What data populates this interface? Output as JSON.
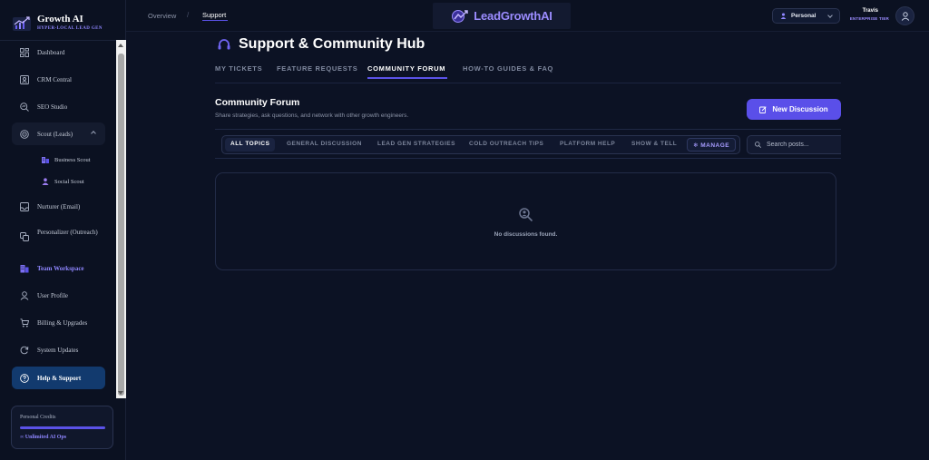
{
  "sidebar": {
    "brand_title": "Growth AI",
    "brand_subtitle": "HYPER-LOCAL LEAD GEN",
    "items": [
      {
        "label": "Dashboard",
        "icon": "grid-icon"
      },
      {
        "label": "CRM Central",
        "icon": "contact-card-icon"
      },
      {
        "label": "SEO Studio",
        "icon": "search-chart-icon"
      },
      {
        "label": "Scout (Leads)",
        "icon": "target-icon",
        "expanded": true
      },
      {
        "label": "Nurturer (Email)",
        "icon": "inbox-icon"
      },
      {
        "label": "Personalizer (Outreach)",
        "icon": "copy-icon"
      },
      {
        "label": "Team Workspace",
        "icon": "building-icon"
      },
      {
        "label": "User Profile",
        "icon": "user-icon"
      },
      {
        "label": "Billing & Upgrades",
        "icon": "cart-icon"
      },
      {
        "label": "System Updates",
        "icon": "refresh-icon"
      },
      {
        "label": "Help & Support",
        "icon": "question-icon",
        "active": true
      }
    ],
    "sub_items": [
      {
        "label": "Business Scout",
        "icon": "buildings-icon"
      },
      {
        "label": "Social Scout",
        "icon": "user-group-icon"
      }
    ],
    "credits": {
      "title": "Personal Credits",
      "ops": "∞ Unlimited AI Ops",
      "fill_fraction": 1.0
    }
  },
  "topbar": {
    "breadcrumb_overview": "Overview",
    "breadcrumb_separator": "/",
    "breadcrumb_current": "Support",
    "brand": "LeadGrowthAI",
    "workspace": "Personal",
    "user_name": "Travis",
    "user_tier": "ENTERPRISE TIER"
  },
  "main": {
    "title": "Support & Community Hub",
    "tabs": [
      {
        "label": "MY TICKETS"
      },
      {
        "label": "FEATURE REQUESTS"
      },
      {
        "label": "COMMUNITY FORUM",
        "active": true
      },
      {
        "label": "HOW-TO GUIDES & FAQ"
      }
    ],
    "forum": {
      "title": "Community Forum",
      "description": "Share strategies, ask questions, and network with other growth engineers.",
      "new_button": "New Discussion",
      "topics": [
        {
          "label": "ALL TOPICS",
          "active": true
        },
        {
          "label": "GENERAL DISCUSSION"
        },
        {
          "label": "LEAD GEN STRATEGIES"
        },
        {
          "label": "COLD OUTREACH TIPS"
        },
        {
          "label": "PLATFORM HELP"
        },
        {
          "label": "SHOW & TELL"
        }
      ],
      "manage_label": "❄ MANAGE",
      "search_placeholder": "Search posts...",
      "empty_text": "No discussions found."
    }
  },
  "colors": {
    "background": "#0c1224",
    "accent": "#5a4fe9",
    "accent_text": "#9b8cff",
    "active_nav": "#123a6e"
  }
}
